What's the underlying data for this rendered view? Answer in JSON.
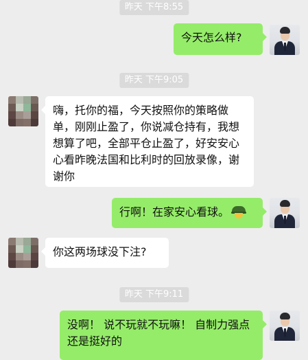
{
  "messages": [
    {
      "type": "time",
      "text": "昨天 下午8:55"
    },
    {
      "type": "out",
      "text": "今天怎么样?"
    },
    {
      "type": "time",
      "text": "昨天 下午9:05"
    },
    {
      "type": "in",
      "text": "嗨，托你的福，今天按照你的策略做单，刚刚止盈了，你说减仓持有，我想想算了吧，全部平仓止盈了，好安安心心看昨晚法国和比利时的回放录像，谢谢你"
    },
    {
      "type": "out",
      "text": "行啊！在家安心看球。",
      "emoji": "army-hat-emoji"
    },
    {
      "type": "in",
      "text": "你这两场球没下注?"
    },
    {
      "type": "time",
      "text": "昨天 下午9:11"
    },
    {
      "type": "out",
      "text": "没啊！ 说不玩就不玩嘛！ 自制力强点还是挺好的"
    }
  ],
  "colors": {
    "background": "#ededed",
    "outgoing_bubble": "#95ec69",
    "incoming_bubble": "#ffffff",
    "timestamp_bg": "#dadada"
  }
}
